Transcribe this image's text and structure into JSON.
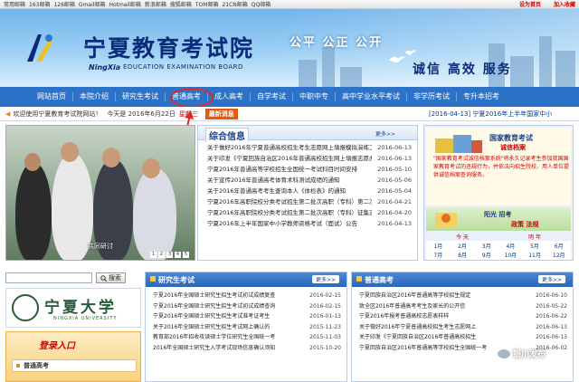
{
  "topbar": {
    "links": [
      "常用邮箱",
      "163邮箱",
      "126邮箱",
      "Gmail邮箱",
      "Hotmail邮箱",
      "新浪邮箱",
      "搜狐邮箱",
      "TOM邮箱",
      "21CN邮箱",
      "QQ邮箱"
    ],
    "set_home": "设为首页",
    "favorite": "加入收藏"
  },
  "header": {
    "title": "宁夏教育考试院",
    "sub_cn": "NingXia",
    "sub_en": "EDUCATION EXAMINATION BOARD",
    "slogan1": "公平 公正 公开",
    "slogan2": "诚信 高效 服务"
  },
  "nav": [
    "网站首页",
    "本院介绍",
    "研究生考试",
    "普通高考",
    "成人高考",
    "自学考试",
    "中职中专",
    "高中学业水平考试",
    "非学历考试",
    "专升本招考"
  ],
  "ticker": {
    "welcome": "欢迎使用宁夏教育考试院网站！",
    "today": "今天是 2016年6月22日",
    "weekday": "星期三",
    "news_tag": "最新消息",
    "news_date": "[2016-04-13]",
    "news_title": "宁夏2016年上半年国家中小"
  },
  "photo": {
    "caption": "共同研讨",
    "dots": [
      "1",
      "2",
      "3",
      "4",
      "5"
    ]
  },
  "news": {
    "title": "综合信息",
    "more": "更多>>",
    "items": [
      {
        "title": "关于做好2016年宁夏普通高校招生考生志愿网上填报模拟演练工作",
        "date": "2016-06-13"
      },
      {
        "title": "关于印发《宁夏回族自治区2016年普通高校招生网上填报志愿办法》（含有能码）",
        "date": "2016-06-13"
      },
      {
        "title": "宁夏2016年普通高等学校招生全国统一考试科目时间安排",
        "date": "2016-05-10"
      },
      {
        "title": "关于宣传2016年普通高考体育术科测试成绩的通知",
        "date": "2016-05-06"
      },
      {
        "title": "关于2016年普通高考考生查询本人《体检表》的通知",
        "date": "2016-05-04"
      },
      {
        "title": "宁夏2016年高职院校分类考试招生第二批次高职（专科）第二次征",
        "date": "2016-04-21"
      },
      {
        "title": "宁夏2016年高职院校分类考试招生第二批次高职（专科）征集志愿",
        "date": "2016-04-20"
      },
      {
        "title": "宁夏2016年上半年国家中小学教师资格考试（面试）公告",
        "date": "2016-04-13"
      }
    ]
  },
  "right": {
    "cert_title": "国家教育考试",
    "cert_sub": "诚信档案",
    "cert_desc": "\"国家教育考试诚信档案系统\"将永久记录考生参加我国国家教育考试的违规行为，并依法向招生院校、用人单位提供诚信档案查询服务。",
    "yg_title": "阳光 招考",
    "yg_sub": "政策 法规",
    "cal_today": "今 天",
    "cal_tomorrow": "明 年",
    "cal_row1": [
      "1月",
      "2月",
      "3月",
      "4月",
      "5月",
      "6月"
    ],
    "cal_row2": [
      "7月",
      "8月",
      "9月",
      "10月",
      "11月",
      "12月"
    ]
  },
  "search": {
    "placeholder": "",
    "button": "搜索"
  },
  "nxu": {
    "name": "宁夏大学",
    "en": "NINGXIA UNIVERSITY"
  },
  "login": {
    "title": "登录入口",
    "item": "普通高考"
  },
  "yjs": {
    "title": "研究生考试",
    "more": "更多>>",
    "items": [
      {
        "title": "宁夏2016年全国硕士研究生招生考试初试成绩复查",
        "date": "2016-02-15"
      },
      {
        "title": "宁夏2016年全国硕士研究生招生考试初试成绩查询",
        "date": "2016-02-15"
      },
      {
        "title": "宁夏2016年全国硕士研究生招生考试准考证考生",
        "date": "2016-01-13"
      },
      {
        "title": "关于2016年全国硕士研究生招生考试网上确认的",
        "date": "2015-11-23"
      },
      {
        "title": "教育部2016年招收攻读硕士学位研究生全国统一考",
        "date": "2015-11-03"
      },
      {
        "title": "2016年全国硕士研究生入学考试现场信息确认须知",
        "date": "2015-10-20"
      }
    ]
  },
  "ptgk": {
    "title": "普通高考",
    "more": "更多>>",
    "items": [
      {
        "title": "宁夏回族自治区2016年普通高等学校招生规定",
        "date": "2016-06-10"
      },
      {
        "title": "致全区2016年普通高考考生及家长的公开信",
        "date": "2016-05-22"
      },
      {
        "title": "宁夏2016年报考普通高校志愿表样样",
        "date": "2016-06-22"
      },
      {
        "title": "关于做好2016年宁夏普通高校招生考生志愿网上",
        "date": "2016-06-13"
      },
      {
        "title": "关于印发《宁夏回族自治区2016年普通高校招生",
        "date": "2016-06-13"
      },
      {
        "title": "宁夏回族自治区2016年普通高等学校招生全国统一考",
        "date": "2016-06-02"
      }
    ]
  },
  "watermark": "银川发布"
}
